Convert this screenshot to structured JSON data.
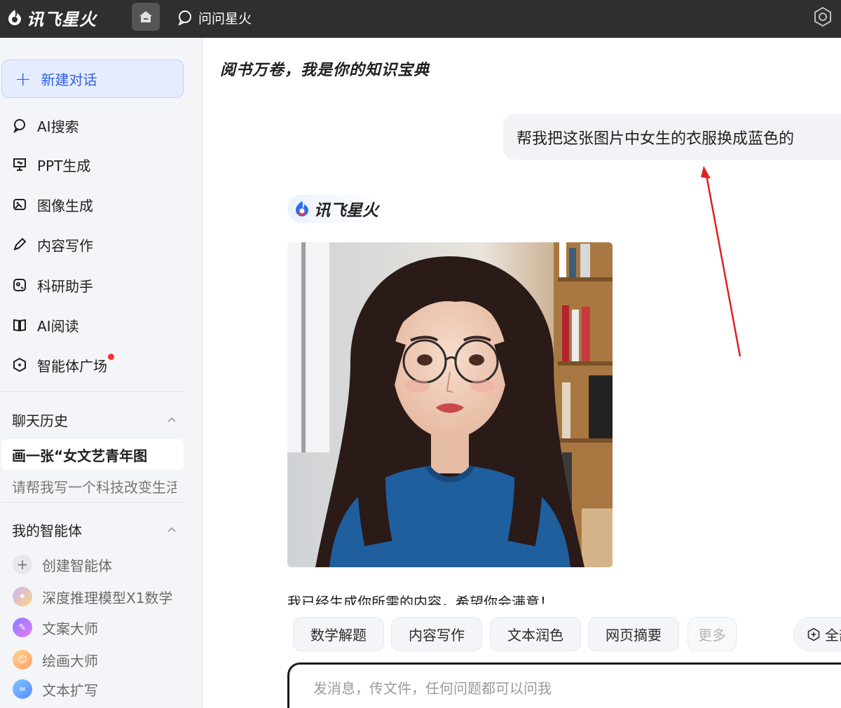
{
  "topbar": {
    "brand": "讯飞星火",
    "ask_label": "问问星火"
  },
  "sidebar": {
    "new_chat": "新建对话",
    "nav": [
      {
        "label": "AI搜索",
        "icon": "search-chat-icon"
      },
      {
        "label": "PPT生成",
        "icon": "ppt-icon"
      },
      {
        "label": "图像生成",
        "icon": "image-gen-icon"
      },
      {
        "label": "内容写作",
        "icon": "pen-icon"
      },
      {
        "label": "科研助手",
        "icon": "research-icon"
      },
      {
        "label": "AI阅读",
        "icon": "book-icon"
      },
      {
        "label": "智能体广场",
        "icon": "agent-plaza-icon"
      }
    ],
    "history_title": "聊天历史",
    "history": [
      "画一张“女文艺青年图",
      "请帮我写一个科技改变生活"
    ],
    "agents_title": "我的智能体",
    "agents": [
      "创建智能体",
      "深度推理模型X1数学",
      "文案大师",
      "绘画大师",
      "文本扩写"
    ]
  },
  "main": {
    "title": "阅书万卷，我是你的知识宝典",
    "user_message": "帮我把这张图片中女生的衣服换成蓝色的",
    "bot_name": "讯飞星火",
    "reply": "我已经生成你所需的内容，希望你会满意！",
    "chips": [
      "数学解题",
      "内容写作",
      "文本润色",
      "网页摘要",
      "更多"
    ],
    "chip_all": "全部",
    "input_placeholder": "发消息，传文件，任何问题都可以问我"
  },
  "colors": {
    "accent": "#3160e6",
    "topbar_bg": "#2f2f2f",
    "sidebar_bg": "#f4f5f8",
    "notification": "#ff2d2d",
    "arrow": "#e02020"
  }
}
